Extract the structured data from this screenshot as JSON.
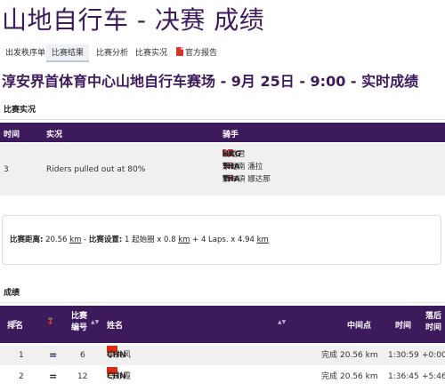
{
  "page": {
    "title": "山地自行车 - 决赛 成绩",
    "venue_heading": "淳安界首体育中心山地自行车赛场 - 9月 25日 - 9:00 - 实时成绩"
  },
  "tabs": [
    {
      "label": "出发秩序单",
      "active": false
    },
    {
      "label": "比赛结果",
      "active": true
    },
    {
      "label": "比赛分析",
      "active": false
    },
    {
      "label": "比赛实况",
      "active": false
    },
    {
      "label": "官方报告",
      "active": false,
      "icon": "pdf-icon"
    }
  ],
  "situation": {
    "section_title": "比赛实况",
    "columns": {
      "time": "时间",
      "situation": "实况",
      "riders": "骑手"
    },
    "row": {
      "time": "3",
      "text": "Riders pulled out at 80%",
      "riders": [
        {
          "bib": "13",
          "noc": "HKG",
          "name": "關皚君",
          "flag": "HKG"
        },
        {
          "bib": "9",
          "noc": "THA",
          "name": "永他南 潘拉",
          "flag": "THA"
        },
        {
          "bib": "10",
          "noc": "THA",
          "name": "素布須 娜达那",
          "flag": "THA"
        }
      ]
    }
  },
  "race_info": {
    "distance_label": "比赛距离:",
    "distance_value": "20.56",
    "distance_unit": "km",
    "setting_label": "比赛设置:",
    "setting_value": "1 起始圈 x 0.8",
    "setting_unit_1": "km",
    "setting_rest": "+ 4 Laps. x 4.94",
    "setting_unit_2": "km"
  },
  "results": {
    "section_title": "成绩",
    "columns": {
      "rank": "排名",
      "bib": "比赛\n编号",
      "name": "姓名",
      "intermediate": "中间点",
      "time": "时间",
      "behind": "落后\n时间"
    },
    "rows": [
      {
        "rank": "1",
        "change": "=",
        "bib": "6",
        "noc": "CHN",
        "name": "李洪风",
        "flag": "CHN",
        "status": "完成",
        "distance": "20.56 km",
        "time": "1:30:59",
        "behind": "+0:00"
      },
      {
        "rank": "2",
        "change": "=",
        "bib": "12",
        "noc": "CHN",
        "name": "马彩霞",
        "flag": "CHN",
        "status": "完成",
        "distance": "20.56 km",
        "time": "1:36:45",
        "behind": "+5:46"
      }
    ]
  },
  "colors": {
    "header_purple": "#3d1a5b",
    "row_gray": "#f0f0f0"
  }
}
